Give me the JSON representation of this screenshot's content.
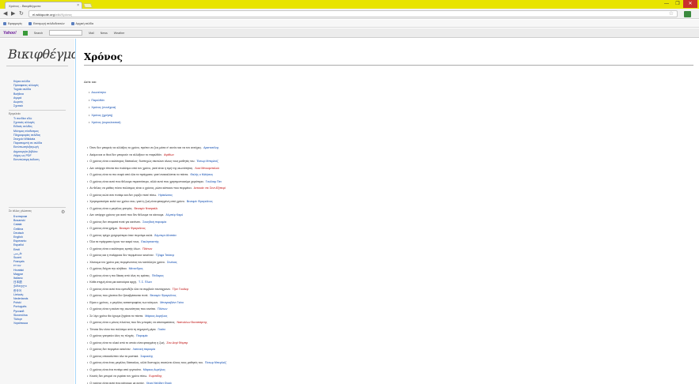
{
  "browser": {
    "tab_title": "Χρόνος - Βικιφθέγματα",
    "tab_close": "×",
    "url_host": "el.wikiquote.org",
    "url_path": "/wiki/Χρόνος",
    "back_icon": "◀",
    "forward_icon": "▶",
    "reload_icon": "↻",
    "star_icon": "☆",
    "window_minimize": "—",
    "window_maximize": "❐",
    "window_close": "✕"
  },
  "bookmarks": [
    "Εφαρμογές",
    "Εισαγωγή σελιδοδεικτών",
    "Αρχική σελίδα"
  ],
  "yahoo_toolbar": {
    "brand": "Yahoo!",
    "search_label": "Search",
    "items": [
      "Mail",
      "News",
      "Weather"
    ]
  },
  "sidebar": {
    "logo": "Βικιφθέγματα",
    "nav_items": [
      "Κύρια σελίδα",
      "Πρόσφατες αλλαγές",
      "Τυχαία σελίδα",
      "Βοήθεια",
      "Αγορά",
      "Δωρεές",
      "Σχετικά"
    ],
    "tools_head": "Εργαλεία",
    "tools_items": [
      "Τι συνδέει εδώ",
      "Σχετικές αλλαγές",
      "Ειδικές σελίδες",
      "Μόνιμος σύνδεσμος",
      "Πληροφορίες σελίδας",
      "Στοιχείο Wikidata",
      "Παραπομπή σε σελίδα",
      "Εκτύπωση/εξαγωγή",
      "Δημιουργία βιβλίου",
      "Λήψη ως PDF",
      "Εκτυπώσιμη έκδοση"
    ],
    "lang_head": "Σε άλλες γλώσσες",
    "lang_gear": "⚙",
    "languages": [
      "Български",
      "Bosanski",
      "Català",
      "Čeština",
      "Deutsch",
      "English",
      "Esperanto",
      "Español",
      "Eesti",
      "فارسی",
      "Suomi",
      "Français",
      "עברית",
      "Hrvatski",
      "Magyar",
      "Italiano",
      "日本語",
      "ქართული",
      "한국어",
      "Lietuvių",
      "Nederlands",
      "Polski",
      "Português",
      "Русский",
      "Slovenčina",
      "Türkçe",
      "Українська"
    ]
  },
  "content": {
    "heading": "Χρόνος",
    "see_also_label": "Δείτε και:",
    "see_also": [
      "Αιωνιότητα",
      "Παρελθόν",
      "Χρόνος (συνέχεια)",
      "Χρόνος (χρήση)",
      "Χρόνος (κυριολεκτικά)"
    ],
    "quotes": [
      {
        "text": "Όταν δεν μπορείς να αλλάξεις το χρόνο, πρέπει να ζεις μέσα σ' αυτόν και να τον αντέχεις.",
        "author": "Αριστοτέλης",
        "red": false
      },
      {
        "text": "Ακόμα και οι θεοί δεν μπορούν να αλλάξουν το παρελθόν.",
        "author": "Αγάθων",
        "red": true
      },
      {
        "text": "Ο χρόνος είναι ο καλύτερος δάσκαλος· δυστυχώς σκοτώνει όλους τους μαθητές του.",
        "author": "Έκτωρ Μπερλιόζ",
        "red": false
      },
      {
        "text": "Δεν υπάρχει τίποτα πιο πολύτιμο από τον χρόνο, γιατί είναι η τιμή της αιωνιότητας.",
        "author": "Λουί Μπουρνταλού",
        "red": true
      },
      {
        "text": "Ο χρόνος είναι το πιο σοφό από όλα τα πράγματα, γιατί ανακαλύπτει τα πάντα.",
        "author": "Θαλής ο Μιλήσιος",
        "red": false
      },
      {
        "text": "Ο χρόνος είναι αυτό που θέλουμε περισσότερο, αλλά αυτό που χρησιμοποιούμε χειρότερα.",
        "author": "Γουίλιαμ Πεν",
        "red": false
      },
      {
        "text": "Αν θέλεις να μάθεις πόσο πολύτιμος είναι ο χρόνος, ρώτα κάποιον που περιμένει.",
        "author": "Αντουάν ντε Σεντ-Εξιπερί",
        "red": true
      },
      {
        "text": "Ο χρόνος κυλά σαν ποτάμι και δεν γυρίζει ποτέ πίσω.",
        "author": "Ηράκλειτος",
        "red": false
      },
      {
        "text": "Χρησιμοποίησε καλά τον χρόνο σου, γιατί η ζωή είναι φτιαγμένη από χρόνο.",
        "author": "Βενιαμίν Φραγκλίνος",
        "red": false
      },
      {
        "text": "Ο χρόνος είναι ο μεγάλος γιατρός.",
        "author": "Βενιαμίν Ντισραέλι",
        "red": true
      },
      {
        "text": "Δεν υπάρχει χρόνος για αυτά που δεν θέλουμε να κάνουμε.",
        "author": "Αλμπέρ Καμύ",
        "red": false
      },
      {
        "text": "Ο χρόνος δεν σταματά ποτέ για κανέναν.",
        "author": "Σουηδική παροιμία",
        "red": false
      },
      {
        "text": "Ο χρόνος είναι χρήμα.",
        "author": "Βενιαμίν Φραγκλίνος",
        "red": true
      },
      {
        "text": "Ο χρόνος τρέχει γρηγορότερα όταν περνάμε καλά.",
        "author": "Άλμπερτ Αϊνστάιν",
        "red": false
      },
      {
        "text": "Όλα τα πράγματα έχουν τον καιρό τους.",
        "author": "Εκκλησιαστής",
        "red": false
      },
      {
        "text": "Ο χρόνος είναι ο καλύτερος κριτής όλων.",
        "author": "Πλάτων",
        "red": true
      },
      {
        "text": "Ο χρόνος και η παλίρροια δεν περιμένουν κανέναν.",
        "author": "Τζέφρι Τσόσερ",
        "red": false
      },
      {
        "text": "Χάνουμε τον χρόνο μας περιμένοντας τον κατάλληλο χρόνο.",
        "author": "Σενέκας",
        "red": false
      },
      {
        "text": "Ο χρόνος δείχνει την αλήθεια.",
        "author": "Μένανδρος",
        "red": false
      },
      {
        "text": "Ο χρόνος είναι η πιο δίκαιη από όλες τις κρίσεις.",
        "author": "Πίνδαρος",
        "red": false
      },
      {
        "text": "Κάθε στιγμή είναι μια καινούρια αρχή.",
        "author": "Τ. Σ. Έλιοτ",
        "red": false
      },
      {
        "text": "Ο χρόνος είναι αυτό που εμποδίζει όλα να συμβούν ταυτόχρονα.",
        "author": "Τζον Γουίλερ",
        "red": true
      },
      {
        "text": "Ο χρόνος που χάνεται δεν ξαναβρίσκεται ποτέ.",
        "author": "Βενιαμίν Φραγκλίνος",
        "red": false
      },
      {
        "text": "Είμαι ο χρόνος, ο μεγάλος καταστροφέας των κόσμων.",
        "author": "Μπαγκαβάντ Γκίτα",
        "red": false
      },
      {
        "text": "Ο χρόνος είναι η εικόνα της αιωνιότητας που κινείται.",
        "author": "Πλάτων",
        "red": false
      },
      {
        "text": "Σε λίγο χρόνο θα έχουμε ξεχάσει τα πάντα.",
        "author": "Μάρκος Αυρήλιος",
        "red": false
      },
      {
        "text": "Ο χρόνος είναι ο μόνος πλούτος που δεν μπορείς να αποταμιεύσεις.",
        "author": "Ναπολέων Βοναπάρτης",
        "red": true
      },
      {
        "text": "Τίποτα δεν είναι πιο πολύτιμο από τη σημερινή μέρα.",
        "author": "Γκαίτε",
        "red": false
      },
      {
        "text": "Ο χρόνος γιατρεύει όλες τις πληγές.",
        "author": "Παροιμία",
        "red": false
      },
      {
        "text": "Ο χρόνος είναι το υλικό από το οποίο είναι φτιαγμένη η ζωή.",
        "author": "Ζαν-Ανρί Φάμπρ",
        "red": true
      },
      {
        "text": "Ο χρόνος δεν περιμένει κανέναν.",
        "author": "Λατινική παροιμία",
        "red": false
      },
      {
        "text": "Ο χρόνος αποκαλύπτει όλα τα μυστικά.",
        "author": "Σοφοκλής",
        "red": false
      },
      {
        "text": "Ο χρόνος είναι ένας μεγάλος δάσκαλος, αλλά δυστυχώς σκοτώνει όλους τους μαθητές του.",
        "author": "Έκτωρ Μπερλιόζ",
        "red": false
      },
      {
        "text": "Ο χρόνος είναι ένα ποτάμι από γεγονότα.",
        "author": "Μάρκος Αυρήλιος",
        "red": false
      },
      {
        "text": "Κανείς δεν μπορεί να γυρίσει τον χρόνο πίσω.",
        "author": "Ευριπίδης",
        "red": true
      },
      {
        "text": "Ο χρόνος είναι αυτό που κάνουμε με αυτόν.",
        "author": "Χένρι Ντέιβιντ Θορό",
        "red": false
      },
      {
        "text": "Το σήμερα είναι ο μαθητής του χθες.",
        "author": "Πούπλιος Σύρος",
        "red": false
      }
    ]
  }
}
